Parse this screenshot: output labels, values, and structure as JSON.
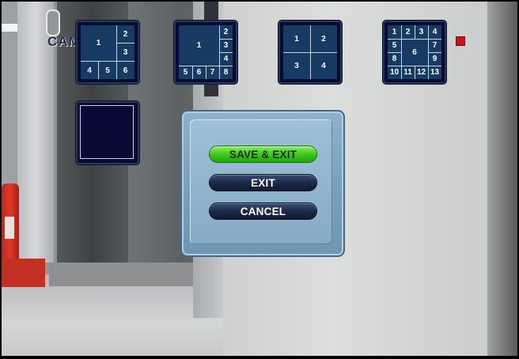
{
  "overlay": {
    "camera_label": "CAM"
  },
  "layouts": {
    "quad_6": {
      "cells": [
        "1",
        "2",
        "3",
        "4",
        "5",
        "6"
      ]
    },
    "split_8": {
      "cells": [
        "1",
        "2",
        "3",
        "4",
        "5",
        "6",
        "7",
        "8"
      ]
    },
    "quad_4": {
      "cells": [
        "1",
        "2",
        "3",
        "4"
      ]
    },
    "split_13": {
      "cells": [
        "1",
        "2",
        "3",
        "4",
        "5",
        "6",
        "7",
        "8",
        "9",
        "10",
        "11",
        "12",
        "13"
      ]
    }
  },
  "dialog": {
    "buttons": {
      "save_exit": "SAVE & EXIT",
      "exit": "EXIT",
      "cancel": "CANCEL"
    }
  },
  "colors": {
    "accent_green": "#3ec81a",
    "tile_bg": "#183b63",
    "record_red": "#d4101b"
  }
}
